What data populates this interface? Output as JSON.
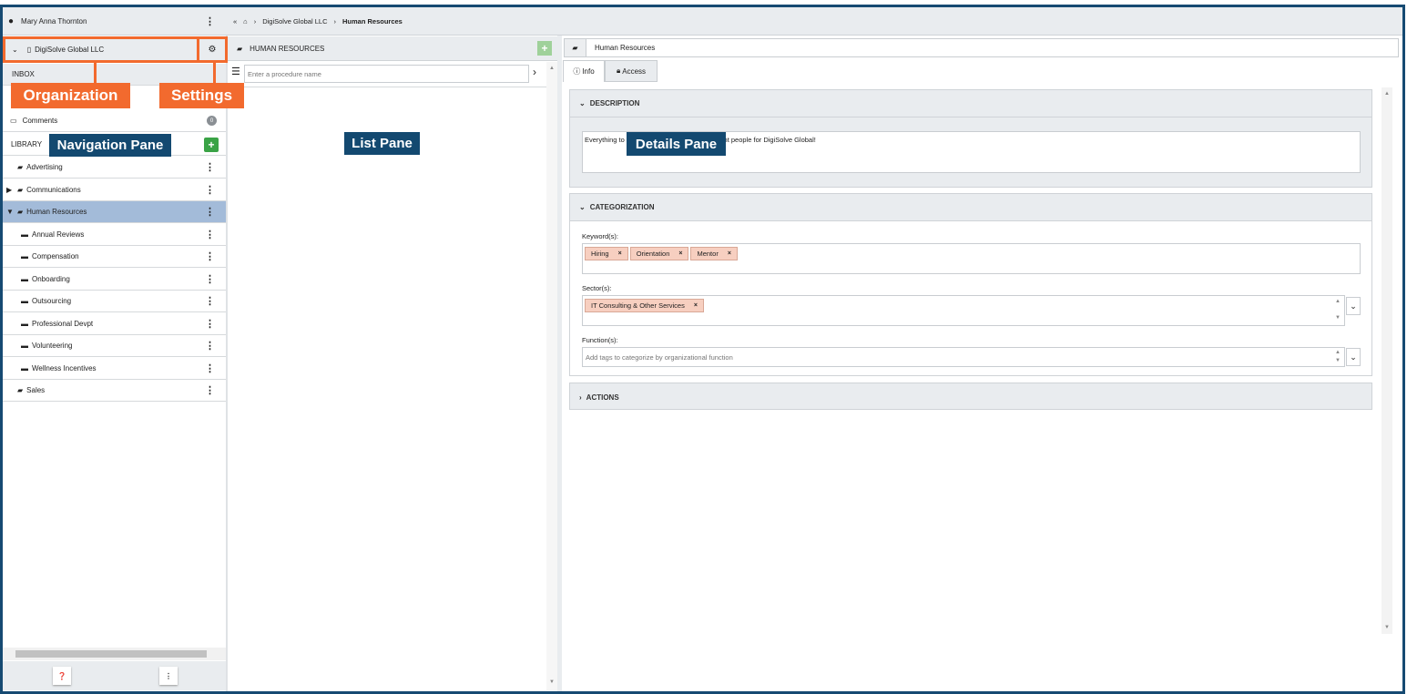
{
  "user": {
    "name": "Mary Anna Thornton"
  },
  "breadcrumb": [
    "DigiSolve Global LLC",
    "Human Resources"
  ],
  "org": {
    "name": "DigiSolve Global LLC"
  },
  "nav": {
    "inbox": "INBOX",
    "comments": "Comments",
    "comments_count": "0",
    "library": "LIBRARY",
    "items": [
      {
        "label": "Advertising",
        "level": 0,
        "expander": ""
      },
      {
        "label": "Communications",
        "level": 0,
        "expander": "▶"
      },
      {
        "label": "Human Resources",
        "level": 0,
        "expander": "▼",
        "selected": true
      },
      {
        "label": "Annual Reviews",
        "level": 1
      },
      {
        "label": "Compensation",
        "level": 1
      },
      {
        "label": "Onboarding",
        "level": 1
      },
      {
        "label": "Outsourcing",
        "level": 1
      },
      {
        "label": "Professional Devpt",
        "level": 1
      },
      {
        "label": "Volunteering",
        "level": 1
      },
      {
        "label": "Wellness Incentives",
        "level": 1
      },
      {
        "label": "Sales",
        "level": 0,
        "expander": ""
      }
    ]
  },
  "list": {
    "title": "HUMAN RESOURCES",
    "search_placeholder": "Enter a procedure name"
  },
  "details": {
    "title": "Human Resources",
    "tabs": [
      "Info",
      "Access"
    ],
    "description_header": "DESCRIPTION",
    "description": "Everything to ... the right people for DigiSolve Global!",
    "description_visible_start": "Everything to",
    "description_visible_end": "he right people for DigiSolve Global!",
    "categorization_header": "CATEGORIZATION",
    "keywords_label": "Keyword(s):",
    "keywords": [
      "Hiring",
      "Orientation",
      "Mentor"
    ],
    "sectors_label": "Sector(s):",
    "sectors": [
      "IT Consulting & Other Services"
    ],
    "functions_label": "Function(s):",
    "functions_placeholder": "Add tags to categorize by organizational function",
    "actions_header": "ACTIONS"
  },
  "callouts": {
    "organization": "Organization",
    "settings": "Settings",
    "navigation": "Navigation Pane",
    "list": "List Pane",
    "details": "Details Pane"
  },
  "colors": {
    "frame": "#164a72",
    "callout_orange": "#f26a2e",
    "callout_blue": "#134970",
    "selected": "#a3bbd9",
    "tag": "#f7cfc0",
    "add_green": "#3aa346"
  }
}
